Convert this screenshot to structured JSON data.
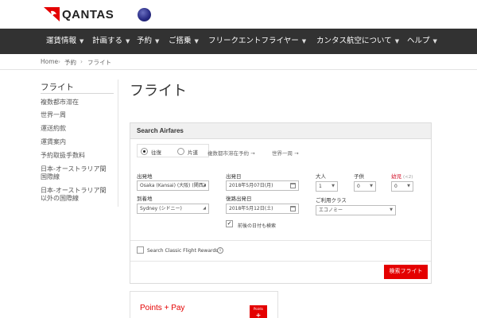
{
  "header": {
    "brand": "QANTAS",
    "nav": [
      {
        "label": "運賃情報"
      },
      {
        "label": "計画する"
      },
      {
        "label": "予約"
      },
      {
        "label": "ご搭乗"
      },
      {
        "label": "フリークエントフライヤー"
      },
      {
        "label": "カンタス航空について"
      },
      {
        "label": "ヘルプ"
      }
    ]
  },
  "breadcrumb": [
    "Home",
    "予約",
    "フライト"
  ],
  "sidebar": {
    "title": "フライト",
    "items": [
      {
        "label": "複数都市滞在"
      },
      {
        "label": "世界一周"
      },
      {
        "label": "運送約款"
      },
      {
        "label": "運賃案内"
      },
      {
        "label": "予約取扱手数料"
      },
      {
        "label": "日本-オーストラリア間",
        "label2": "国際線"
      },
      {
        "label": "日本-オーストラリア間",
        "label2": "以外の国際線"
      }
    ]
  },
  "page_title": "フライト",
  "search": {
    "heading": "Search Airfares",
    "trip_types": [
      {
        "label": "往復",
        "selected": true
      },
      {
        "label": "片道",
        "selected": false
      }
    ],
    "multi_city_link": "複数都市滞在予約 →",
    "rtw_link": "世界一周 →",
    "origin_label": "出発地",
    "origin_value": "Osaka (Kansai) (大阪) (関西)",
    "destination_label": "到着地",
    "destination_value": "Sydney (シドニー)",
    "depart_label": "出発日",
    "depart_value": "2018年5月07日(月)",
    "return_label": "復路出発日",
    "return_value": "2018年5月12日(土)",
    "flexible_label": "前後の日付も検索",
    "flexible_checked": true,
    "adults_label": "大人",
    "adults_value": "1",
    "children_label": "子供",
    "children_value": "0",
    "infants_label": "幼児",
    "infants_note": "(<2)",
    "infants_value": "0",
    "class_label": "ご利用クラス",
    "class_value": "エコノミー",
    "rewards_label": "Search Classic Flight Rewards",
    "rewards_checked": false,
    "submit_label": "検索フライト"
  },
  "promo": {
    "title": "Points + Pay",
    "badge_top": "Points",
    "badge_plus": "+"
  },
  "colors": {
    "brand_red": "#e40000",
    "nav_bg": "#323232"
  }
}
